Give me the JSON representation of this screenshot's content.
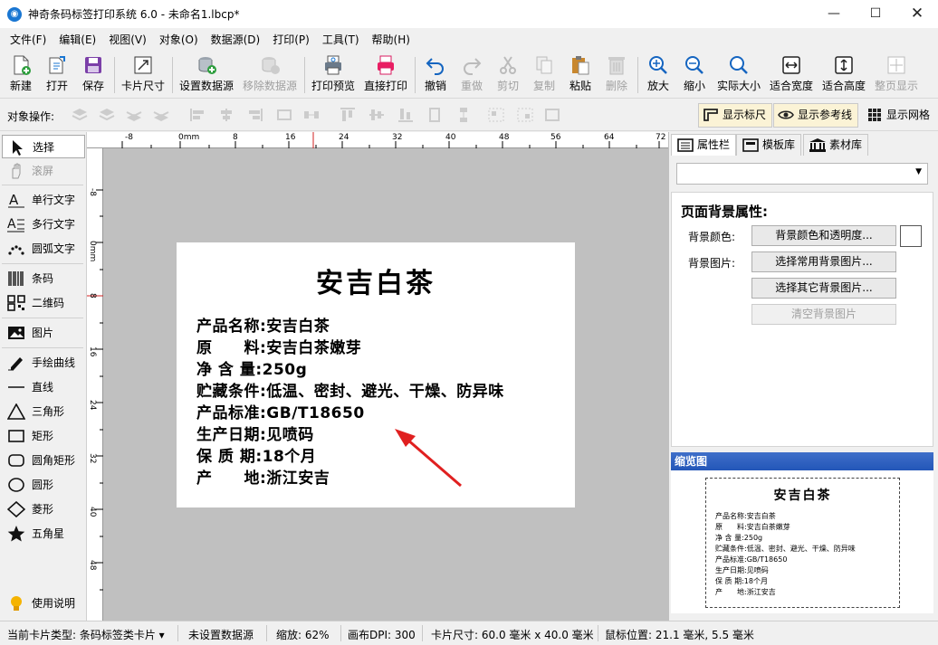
{
  "window": {
    "title": "神奇条码标签打印系统 6.0 - 未命名1.lbcp*",
    "app_icon": "app-logo-icon"
  },
  "menu": [
    "文件(F)",
    "编辑(E)",
    "视图(V)",
    "对象(O)",
    "数据源(D)",
    "打印(P)",
    "工具(T)",
    "帮助(H)"
  ],
  "toolbar": {
    "new": "新建",
    "open": "打开",
    "save": "保存",
    "card_size": "卡片尺寸",
    "set_datasource": "设置数据源",
    "remove_datasource": "移除数据源",
    "print_preview": "打印预览",
    "direct_print": "直接打印",
    "undo": "撤销",
    "redo": "重做",
    "cut": "剪切",
    "copy": "复制",
    "paste": "粘贴",
    "delete": "删除",
    "zoom_in": "放大",
    "zoom_out": "缩小",
    "actual_size": "实际大小",
    "fit_width": "适合宽度",
    "fit_height": "适合高度",
    "fit_page": "整页显示"
  },
  "opsbar": {
    "label": "对象操作:",
    "show_ruler": "显示标尺",
    "show_guides": "显示参考线",
    "show_grid": "显示网格"
  },
  "tools": [
    "选择",
    "滚屏",
    "单行文字",
    "多行文字",
    "圆弧文字",
    "条码",
    "二维码",
    "图片",
    "手绘曲线",
    "直线",
    "三角形",
    "矩形",
    "圆角矩形",
    "圆形",
    "菱形",
    "五角星",
    "使用说明"
  ],
  "ruler": {
    "h": [
      "-8",
      "0mm",
      "8",
      "16",
      "24",
      "32",
      "40",
      "48",
      "56",
      "64",
      "72"
    ],
    "v": [
      "-8",
      "0mm",
      "8",
      "16",
      "24",
      "32",
      "40",
      "48"
    ]
  },
  "label": {
    "title": "安吉白茶",
    "rows": [
      "产品名称:安吉白茶",
      "原　　料:安吉白茶嫩芽",
      "净 含 量:250g",
      "贮藏条件:低温、密封、避光、干燥、防异味",
      "产品标准:GB/T18650",
      "生产日期:见喷码",
      "保 质 期:18个月",
      "产　　地:浙江安吉"
    ]
  },
  "rightpanel": {
    "tabs": [
      "属性栏",
      "模板库",
      "素材库"
    ],
    "prop_title": "页面背景属性:",
    "bg_color_label": "背景颜色:",
    "bg_color_btn": "背景颜色和透明度...",
    "bg_image_label": "背景图片:",
    "bg_common_btn": "选择常用背景图片...",
    "bg_other_btn": "选择其它背景图片...",
    "bg_clear_btn": "清空背景图片",
    "thumb_header": "缩览图"
  },
  "statusbar": {
    "card_type": "当前卡片类型: 条码标签类卡片 ▾",
    "datasource": "未设置数据源",
    "zoom": "缩放: 62%",
    "dpi": "画布DPI: 300",
    "card_size": "卡片尺寸: 60.0 毫米 x 40.0 毫米",
    "mouse_pos": "鼠标位置: 21.1 毫米, 5.5 毫米"
  },
  "colors": {
    "accent": "#2356b8",
    "canvas_bg": "#c0c0c0",
    "arrow": "#e02020"
  }
}
